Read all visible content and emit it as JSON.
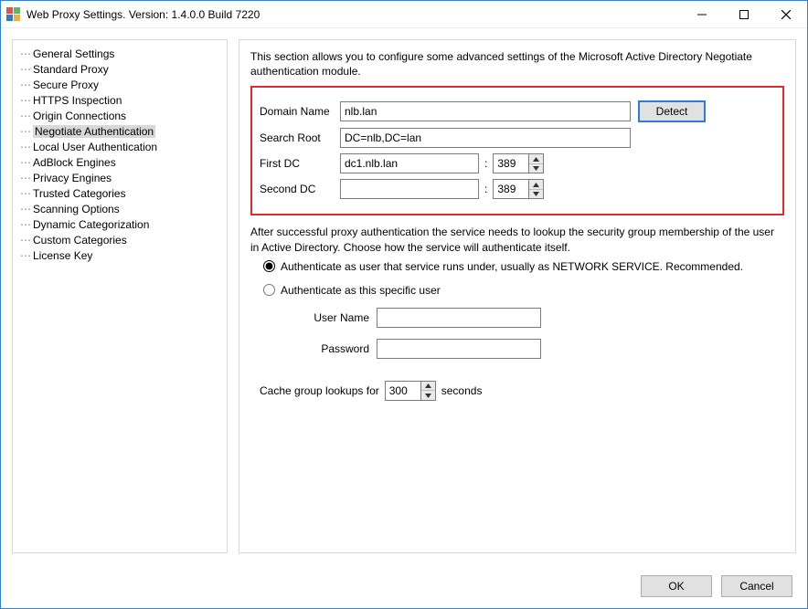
{
  "window": {
    "title": "Web Proxy Settings. Version: 1.4.0.0 Build 7220"
  },
  "sidebar": {
    "selected_index": 5,
    "items": [
      "General Settings",
      "Standard Proxy",
      "Secure Proxy",
      "HTTPS Inspection",
      "Origin Connections",
      "Negotiate Authentication",
      "Local User Authentication",
      "AdBlock Engines",
      "Privacy Engines",
      "Trusted Categories",
      "Scanning Options",
      "Dynamic Categorization",
      "Custom Categories",
      "License Key"
    ]
  },
  "main": {
    "intro": "This section allows you to configure some advanced settings of the Microsoft Active Directory Negotiate authentication module.",
    "labels": {
      "domain_name": "Domain Name",
      "search_root": "Search Root",
      "first_dc": "First DC",
      "second_dc": "Second DC",
      "detect": "Detect"
    },
    "values": {
      "domain_name": "nlb.lan",
      "search_root": "DC=nlb,DC=lan",
      "first_dc_host": "dc1.nlb.lan",
      "first_dc_port": "389",
      "second_dc_host": "",
      "second_dc_port": "389"
    },
    "para2": "After successful proxy authentication the service needs to lookup the security group membership of the user in Active Directory. Choose how the service will authenticate itself.",
    "radios": {
      "opt1": "Authenticate as user that service runs under, usually as NETWORK SERVICE. Recommended.",
      "opt2": "Authenticate as this specific user"
    },
    "creds": {
      "user_label": "User Name",
      "pass_label": "Password",
      "user_value": "",
      "pass_value": ""
    },
    "cache": {
      "prefix": "Cache group lookups for",
      "value": "300",
      "suffix": "seconds"
    }
  },
  "footer": {
    "ok": "OK",
    "cancel": "Cancel"
  }
}
